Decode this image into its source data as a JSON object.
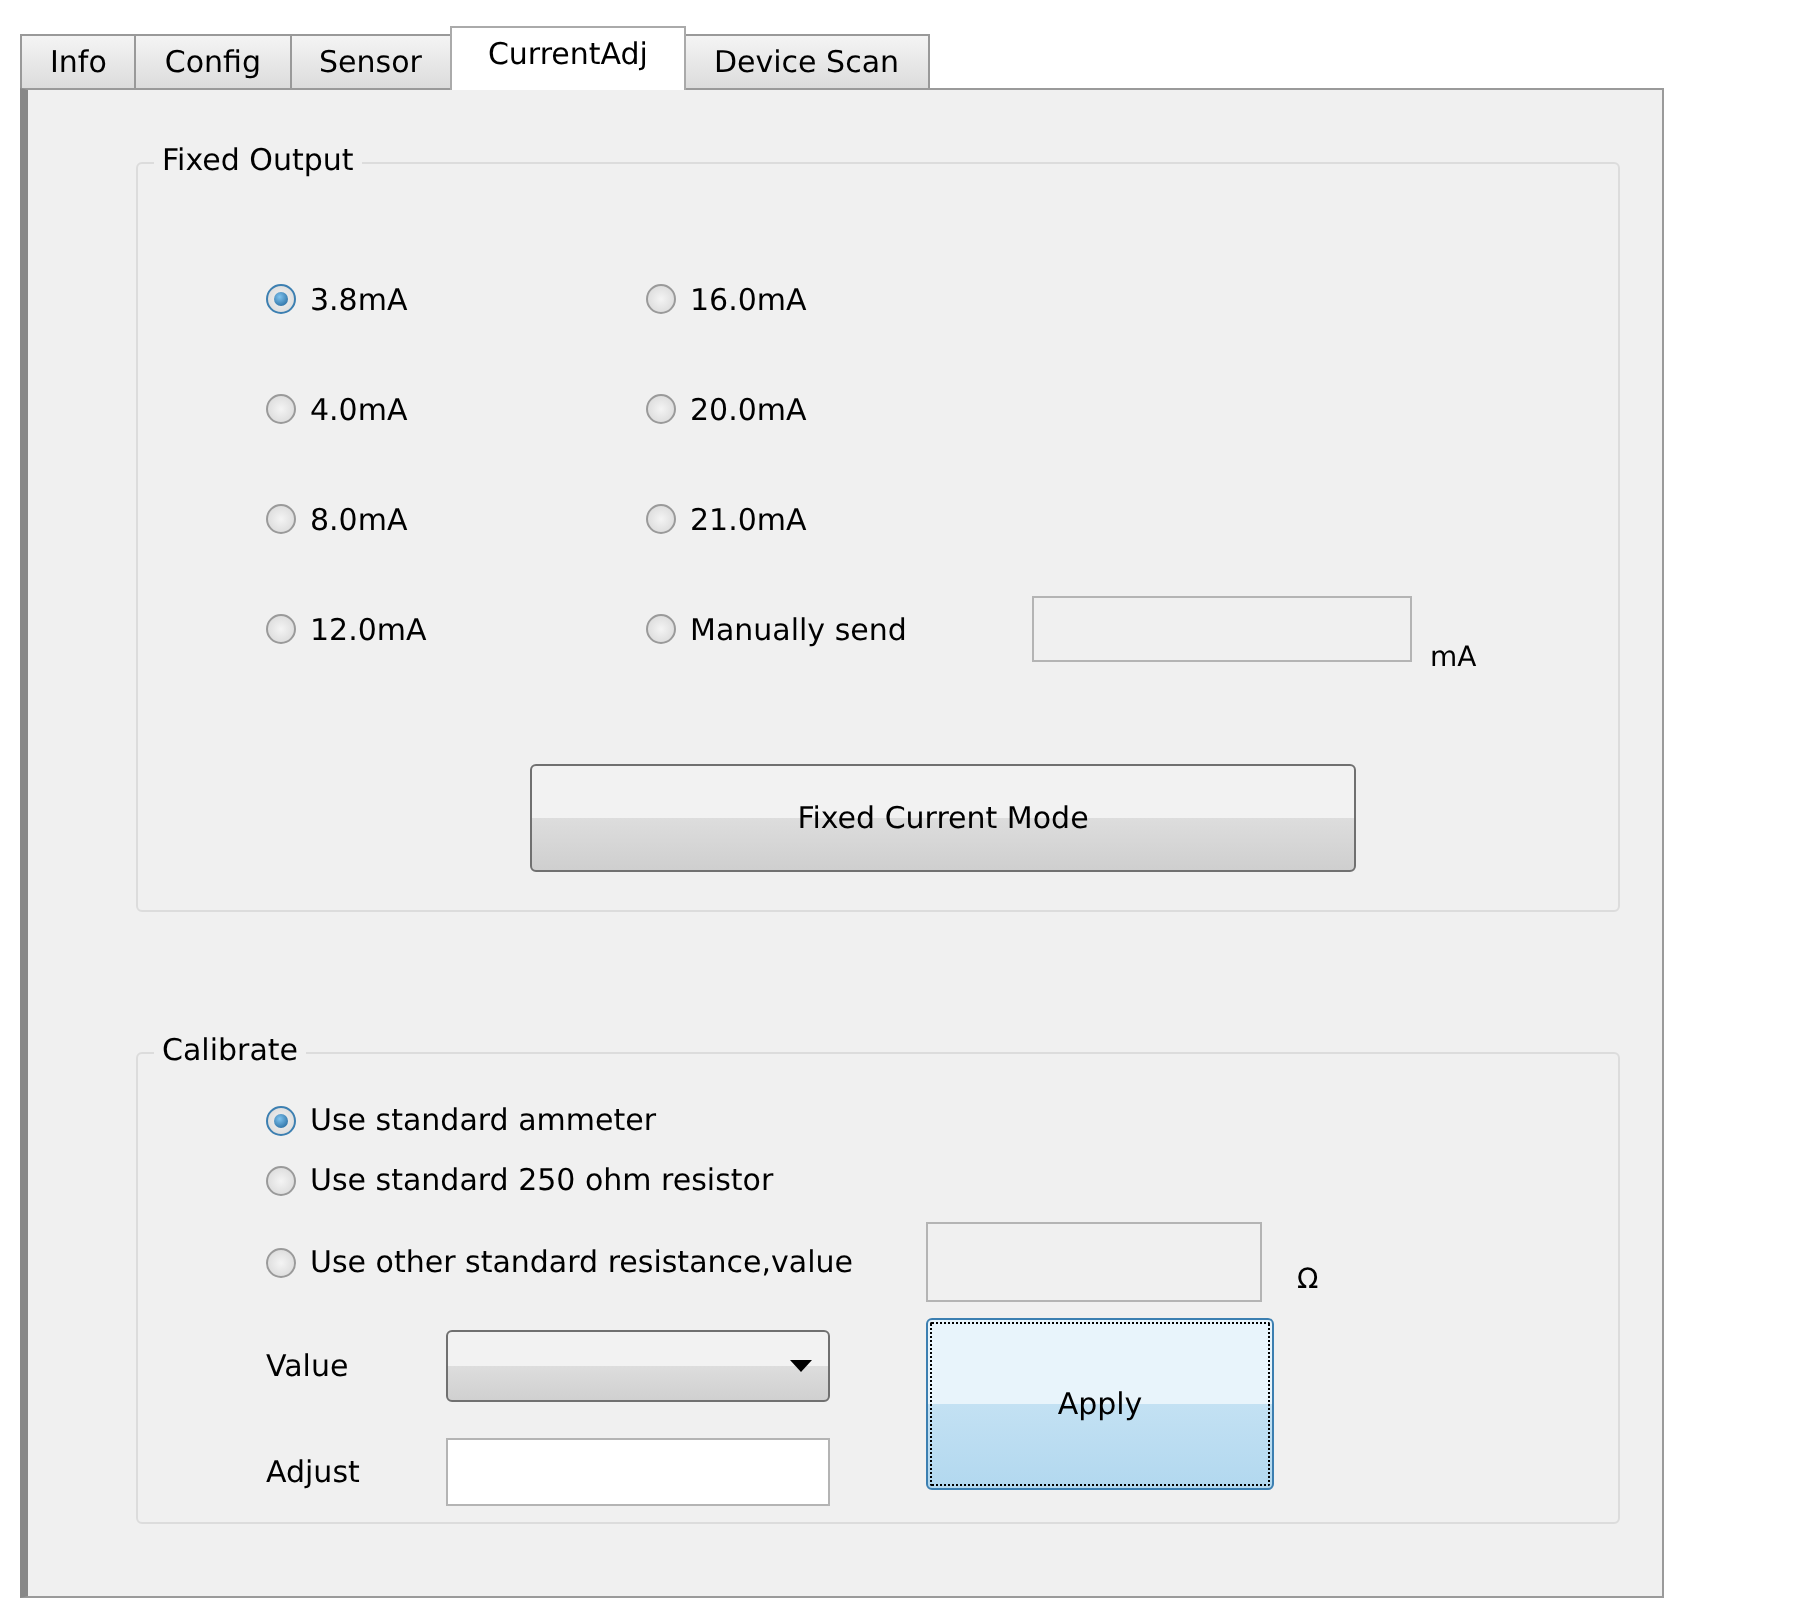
{
  "tabs": [
    {
      "label": "Info",
      "selected": false
    },
    {
      "label": "Config",
      "selected": false
    },
    {
      "label": "Sensor",
      "selected": false
    },
    {
      "label": "CurrentAdj",
      "selected": true
    },
    {
      "label": "Device Scan",
      "selected": false
    }
  ],
  "fixed_output": {
    "title": "Fixed Output",
    "options": [
      {
        "label": "3.8mA",
        "selected": true
      },
      {
        "label": "4.0mA",
        "selected": false
      },
      {
        "label": "8.0mA",
        "selected": false
      },
      {
        "label": "12.0mA",
        "selected": false
      },
      {
        "label": "16.0mA",
        "selected": false
      },
      {
        "label": "20.0mA",
        "selected": false
      },
      {
        "label": "21.0mA",
        "selected": false
      },
      {
        "label": "Manually send",
        "selected": false
      }
    ],
    "manual_field": {
      "disabled": true
    },
    "unit": "mA",
    "button": "Fixed Current Mode"
  },
  "calibrate": {
    "title": "Calibrate",
    "options": [
      {
        "label": "Use standard ammeter",
        "selected": true
      },
      {
        "label": "Use standard 250 ohm resistor",
        "selected": false
      },
      {
        "label": "Use other standard resistance,value",
        "selected": false
      }
    ],
    "resistance_field": {
      "disabled": true
    },
    "resistance_unit": "Ω",
    "value_label": "Value",
    "adjust_label": "Adjust",
    "adjust_field": {
      "disabled": false
    },
    "apply": {
      "label": "Apply",
      "focused": true
    }
  }
}
